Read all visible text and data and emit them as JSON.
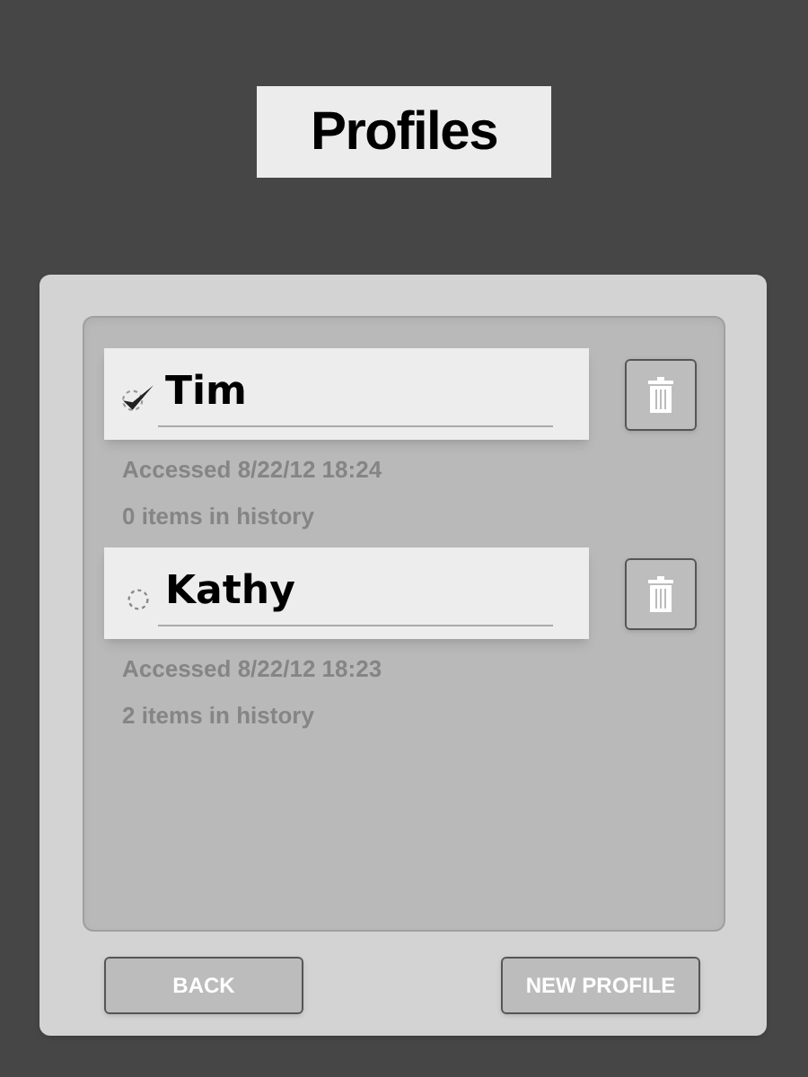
{
  "title": "Profiles",
  "profiles": [
    {
      "name": "Tim",
      "selected": true,
      "accessed": "Accessed 8/22/12 18:24",
      "history": "0 items in history"
    },
    {
      "name": "Kathy",
      "selected": false,
      "accessed": "Accessed 8/22/12 18:23",
      "history": "2 items in history"
    }
  ],
  "buttons": [
    "BACK",
    "NEW PROFILE"
  ]
}
